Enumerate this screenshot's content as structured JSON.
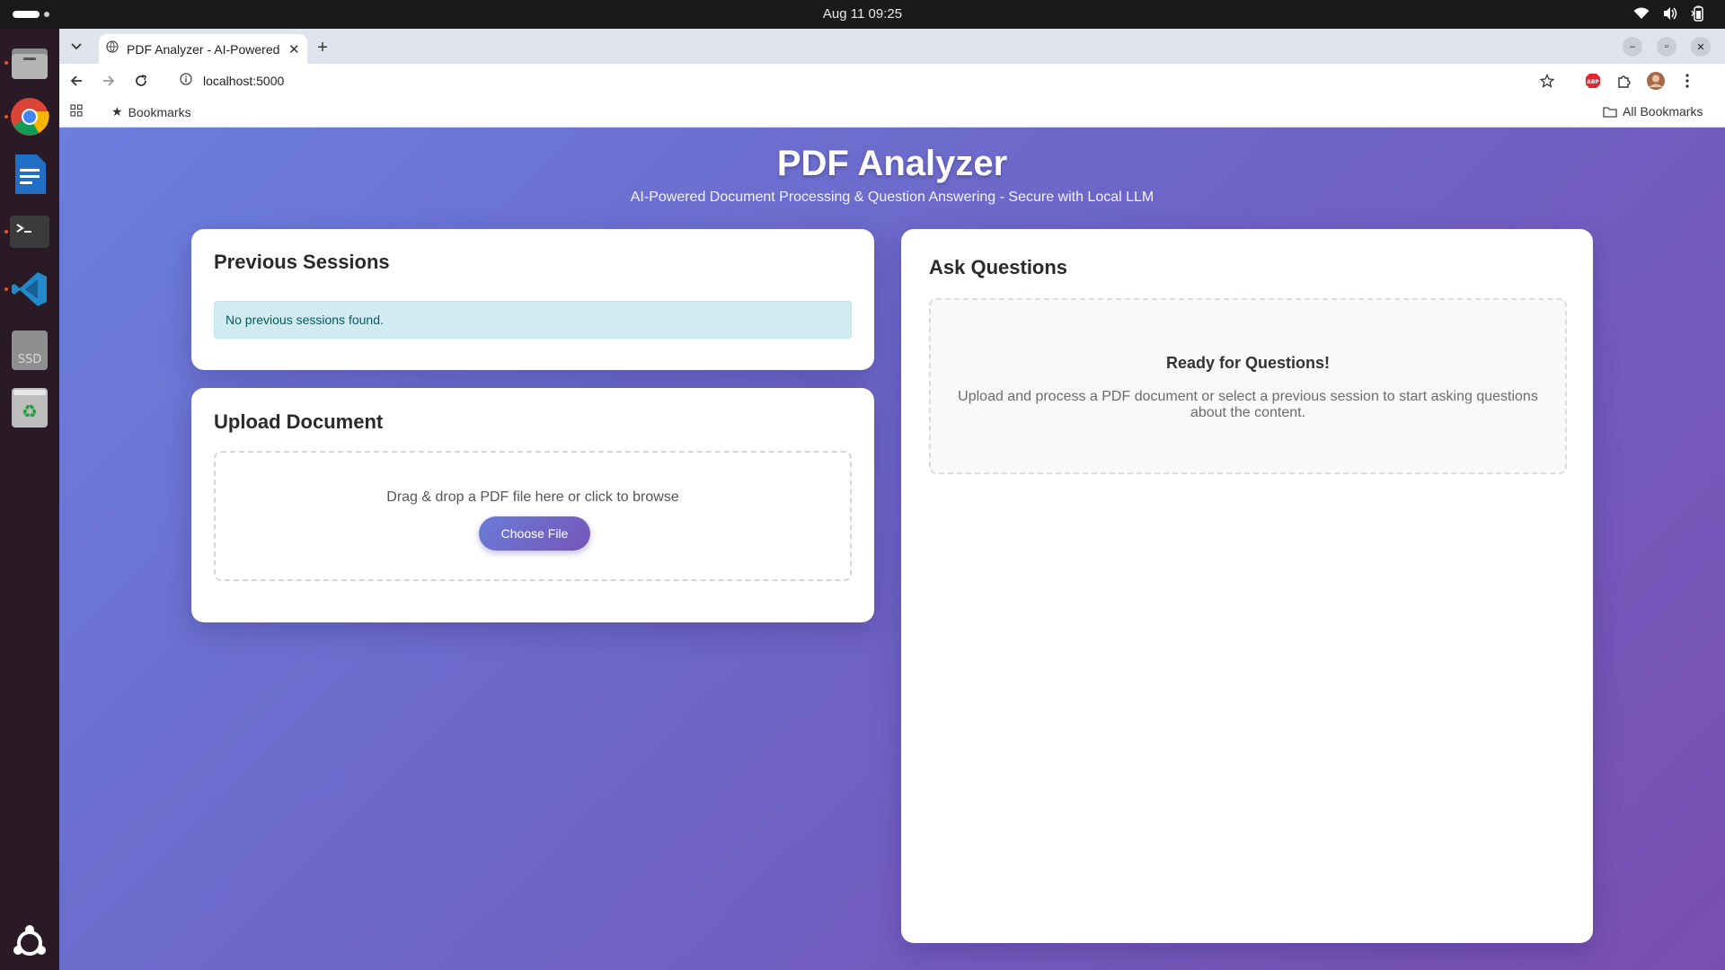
{
  "system": {
    "datetime": "Aug 11  09:25"
  },
  "browser": {
    "tab_title": "PDF Analyzer - AI-Powered Document Processing",
    "url": "localhost:5000",
    "bookmarks_label": "Bookmarks",
    "all_bookmarks_label": "All Bookmarks"
  },
  "page": {
    "title": "PDF Analyzer",
    "subtitle": "AI-Powered Document Processing & Question Answering - Secure with Local LLM",
    "sessions": {
      "heading": "Previous Sessions",
      "empty_message": "No previous sessions found."
    },
    "upload": {
      "heading": "Upload Document",
      "drop_text": "Drag & drop a PDF file here or click to browse",
      "button_label": "Choose File"
    },
    "ask": {
      "heading": "Ask Questions",
      "ready_title": "Ready for Questions!",
      "ready_text": "Upload and process a PDF document or select a previous session to start asking questions about the content."
    }
  },
  "dock": {
    "items": [
      "files-icon",
      "chrome-icon",
      "writer-icon",
      "terminal-icon",
      "vscode-icon",
      "ssd-icon",
      "trash-icon",
      "ubuntu-logo-icon"
    ],
    "ssd_label": "SSD"
  },
  "colors": {
    "gradient_start": "#6b7fdd",
    "gradient_end": "#7a4fb0",
    "info_bg": "#d1ecf1",
    "info_text": "#0c5460"
  }
}
